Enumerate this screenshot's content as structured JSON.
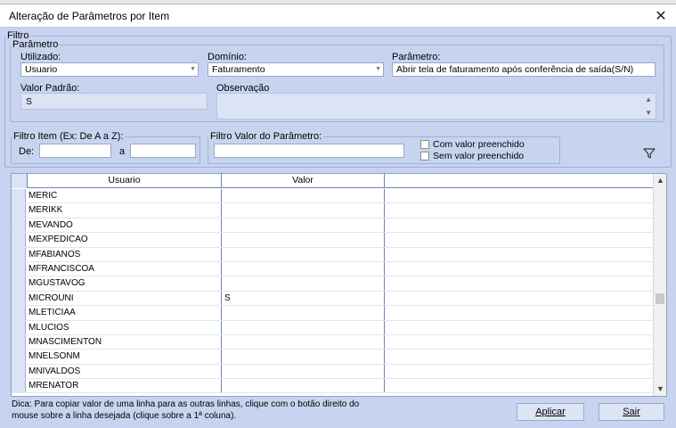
{
  "window": {
    "title": "Alteração de Parâmetros por Item"
  },
  "filtro": {
    "legend": "Filtro",
    "parametro_group": {
      "legend": "Parâmetro",
      "utilizado": {
        "label": "Utilizado:",
        "value": "Usuario"
      },
      "dominio": {
        "label": "Domínio:",
        "value": "Faturamento"
      },
      "parametro": {
        "label": "Parâmetro:",
        "value": "Abrir tela de faturamento após conferência de saída(S/N)"
      },
      "valor_padrao": {
        "label": "Valor Padrão:",
        "value": "S"
      },
      "observacao": {
        "label": "Observação",
        "value": ""
      }
    },
    "filtro_item": {
      "legend": "Filtro Item (Ex: De A a Z):",
      "de_label": "De:",
      "a_label": "a",
      "de_value": "",
      "a_value": ""
    },
    "filtro_valor": {
      "legend": "Filtro Valor do Parâmetro:",
      "value": "",
      "com_valor": "Com valor preenchido",
      "sem_valor": "Sem valor preenchido"
    }
  },
  "grid": {
    "headers": [
      "Usuario",
      "Valor"
    ],
    "rows": [
      {
        "usuario": "MERIC",
        "valor": ""
      },
      {
        "usuario": "MERIKK",
        "valor": ""
      },
      {
        "usuario": "MEVANDO",
        "valor": ""
      },
      {
        "usuario": "MEXPEDICAO",
        "valor": ""
      },
      {
        "usuario": "MFABIANOS",
        "valor": ""
      },
      {
        "usuario": "MFRANCISCOA",
        "valor": ""
      },
      {
        "usuario": "MGUSTAVOG",
        "valor": ""
      },
      {
        "usuario": "MICROUNI",
        "valor": "S"
      },
      {
        "usuario": "MLETICIAA",
        "valor": ""
      },
      {
        "usuario": "MLUCIOS",
        "valor": ""
      },
      {
        "usuario": "MNASCIMENTON",
        "valor": ""
      },
      {
        "usuario": "MNELSONM",
        "valor": ""
      },
      {
        "usuario": "MNIVALDOS",
        "valor": ""
      },
      {
        "usuario": "MRENATOR",
        "valor": ""
      }
    ]
  },
  "footer": {
    "tip": "Dica: Para copiar valor de uma linha para as outras linhas, clique com o botão direito do mouse sobre a linha desejada (clique sobre a 1ª coluna).",
    "aplicar": "Aplicar",
    "sair": "Sair"
  }
}
